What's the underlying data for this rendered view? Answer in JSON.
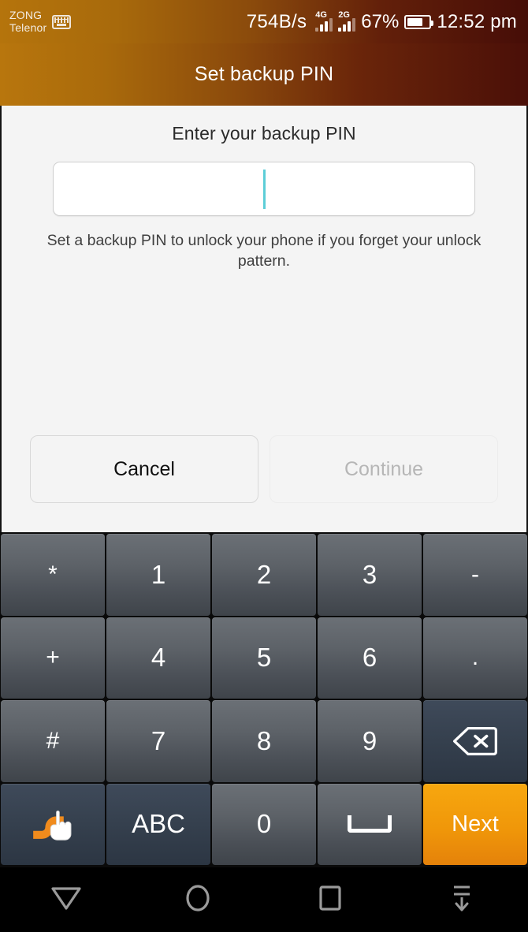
{
  "statusbar": {
    "carrier_sim1": "ZONG",
    "carrier_sim2": "Telenor",
    "keyboard_icon": "keyboard-icon",
    "network_speed": "754B/s",
    "signal1_label": "4G",
    "signal2_label": "2G",
    "battery_percent": "67%",
    "clock": "12:52 pm"
  },
  "titlebar": {
    "title": "Set backup PIN",
    "gradient_start": "#b8760d",
    "gradient_end": "#4a0f08"
  },
  "content": {
    "prompt": "Enter your backup PIN",
    "pin_value": "",
    "pin_placeholder": "",
    "caret_color": "#5ccdd7",
    "help_text": "Set a backup PIN to unlock your phone if you forget your unlock pattern.",
    "cancel_label": "Cancel",
    "continue_label": "Continue",
    "continue_enabled": false
  },
  "keyboard": {
    "rows": [
      [
        {
          "label": "*",
          "name": "key-asterisk",
          "type": "sym"
        },
        {
          "label": "1",
          "name": "key-1",
          "type": "num"
        },
        {
          "label": "2",
          "name": "key-2",
          "type": "num"
        },
        {
          "label": "3",
          "name": "key-3",
          "type": "num"
        },
        {
          "label": "-",
          "name": "key-hyphen",
          "type": "sym"
        }
      ],
      [
        {
          "label": "+",
          "name": "key-plus",
          "type": "sym"
        },
        {
          "label": "4",
          "name": "key-4",
          "type": "num"
        },
        {
          "label": "5",
          "name": "key-5",
          "type": "num"
        },
        {
          "label": "6",
          "name": "key-6",
          "type": "num"
        },
        {
          "label": ".",
          "name": "key-period",
          "type": "sym"
        }
      ],
      [
        {
          "label": "#",
          "name": "key-hash",
          "type": "sym"
        },
        {
          "label": "7",
          "name": "key-7",
          "type": "num"
        },
        {
          "label": "8",
          "name": "key-8",
          "type": "num"
        },
        {
          "label": "9",
          "name": "key-9",
          "type": "num"
        },
        {
          "label": "",
          "name": "key-backspace",
          "type": "icon-backspace"
        }
      ],
      [
        {
          "label": "",
          "name": "key-swipe-input",
          "type": "icon-swipe"
        },
        {
          "label": "ABC",
          "name": "key-abc",
          "type": "func"
        },
        {
          "label": "0",
          "name": "key-0",
          "type": "num"
        },
        {
          "label": "",
          "name": "key-space",
          "type": "icon-space"
        },
        {
          "label": "Next",
          "name": "key-next",
          "type": "next"
        }
      ]
    ],
    "key_color": "#5d6268",
    "func_color": "#36414f",
    "next_color": "#f09709"
  },
  "navbar": {
    "back": "back-icon",
    "home": "home-icon",
    "recents": "recents-icon",
    "hide_keyboard": "hide-keyboard-icon"
  }
}
